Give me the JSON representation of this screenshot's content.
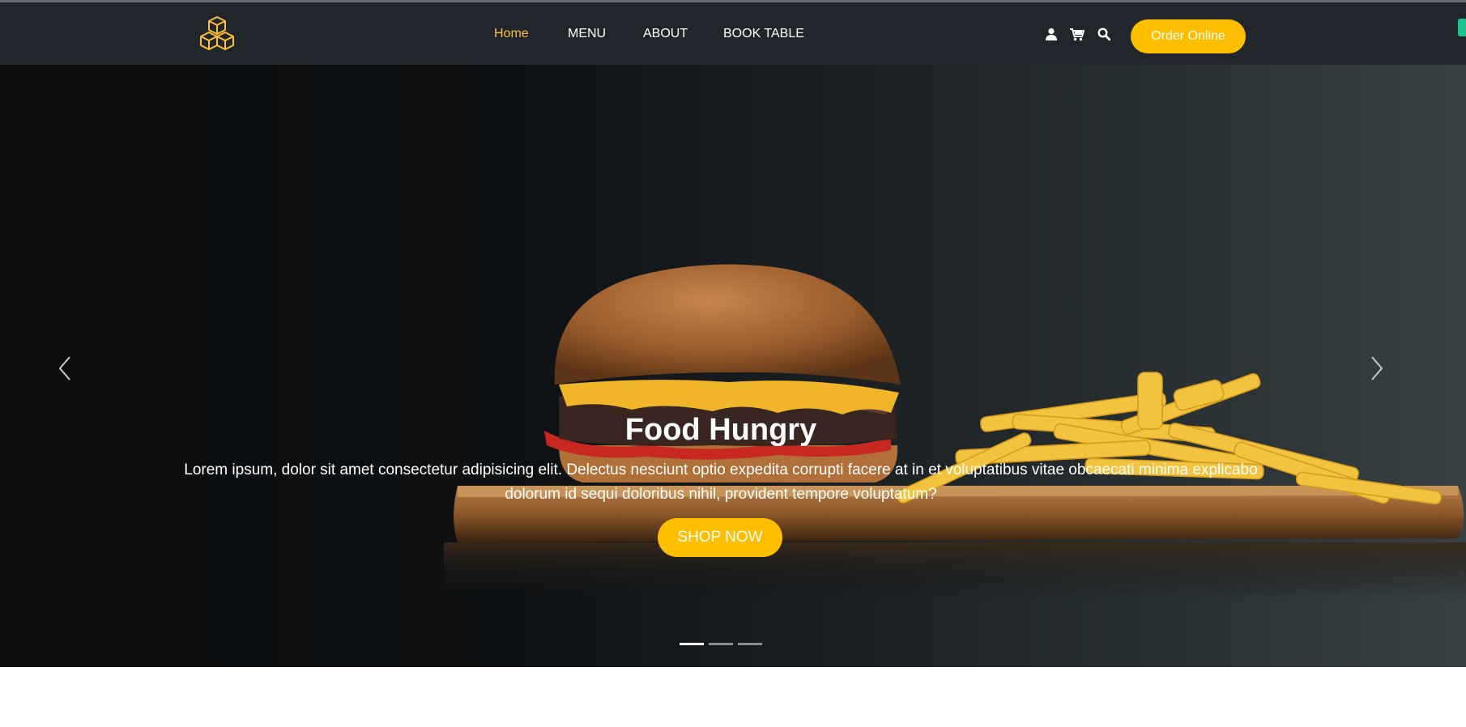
{
  "header": {
    "nav": [
      {
        "label": "Home",
        "active": true
      },
      {
        "label": "MENU",
        "active": false
      },
      {
        "label": "ABOUT",
        "active": false
      },
      {
        "label": "BOOK TABLE",
        "active": false
      }
    ],
    "icons": [
      "user-icon",
      "cart-icon",
      "search-icon"
    ],
    "order_button": "Order Online"
  },
  "hero": {
    "title": "Food Hungry",
    "text": "Lorem ipsum, dolor sit amet consectetur adipisicing elit. Delectus nesciunt optio expedita corrupti facere at in et voluptatibus vitae obcaecati minima explicabo dolorum id sequi doloribus nihil, provident tempore voluptatum?",
    "button": "SHOP NOW",
    "slides": 3,
    "active_slide": 1
  },
  "colors": {
    "accent": "#ffbe33",
    "button": "#ffbe00",
    "header_bg": "#20262b"
  }
}
